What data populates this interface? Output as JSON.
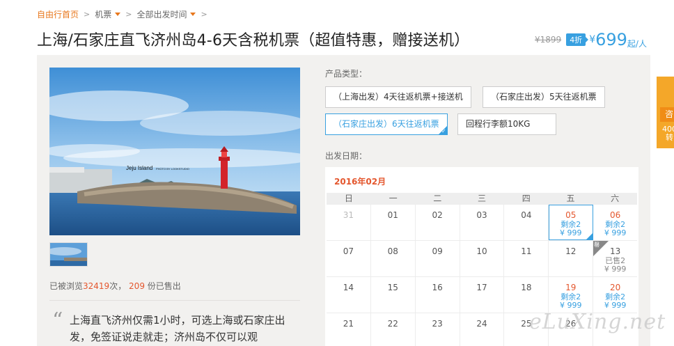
{
  "breadcrumb": {
    "home": "自由行首页",
    "category": "机票",
    "date_filter": "全部出发时间"
  },
  "title": "上海/石家庄直飞济州岛4-6天含税机票（超值特惠，赠接送机）",
  "price": {
    "original": "¥1899",
    "discount": "4折",
    "currency": "¥",
    "current": "699",
    "unit": "起/人"
  },
  "gallery": {
    "photo_caption": "Jeju Island",
    "photo_credit": "PHOTO BY LOOKSTUDIO"
  },
  "stats": {
    "prefix": "已被浏览",
    "views": "32419",
    "mid": "次，",
    "sold": "209",
    "suffix": "份已售出"
  },
  "description": "上海直飞济州仅需1小时，可选上海或石家庄出发，免签证说走就走；济州岛不仅可以观",
  "product": {
    "label": "产品类型：",
    "options": [
      "（上海出发）4天往返机票+接送机",
      "（石家庄出发）5天往返机票",
      "（石家庄出发）6天往返机票",
      "回程行李额10KG"
    ]
  },
  "date_label": "出发日期：",
  "calendar": {
    "month": "2016年02月",
    "weekdays": [
      "日",
      "一",
      "二",
      "三",
      "四",
      "五",
      "六"
    ],
    "row1": [
      "31",
      "01",
      "02",
      "03",
      "04",
      "05",
      "06"
    ],
    "row2": [
      "07",
      "08",
      "09",
      "10",
      "11",
      "12",
      "13"
    ],
    "row3": [
      "14",
      "15",
      "16",
      "17",
      "18",
      "19",
      "20"
    ],
    "row4": [
      "21",
      "22",
      "23",
      "24",
      "25",
      "26",
      ""
    ],
    "remain_text": "剩余2",
    "price_text": "¥ 999",
    "soldout_text": "已售2",
    "soldout_badge": "罄"
  },
  "side": {
    "text1": "咨",
    "text2": "400 转"
  },
  "watermark": "eLuXing.net",
  "colors": {
    "accent_blue": "#38a0e0",
    "orange": "#e8771c",
    "red": "#e4572e"
  }
}
